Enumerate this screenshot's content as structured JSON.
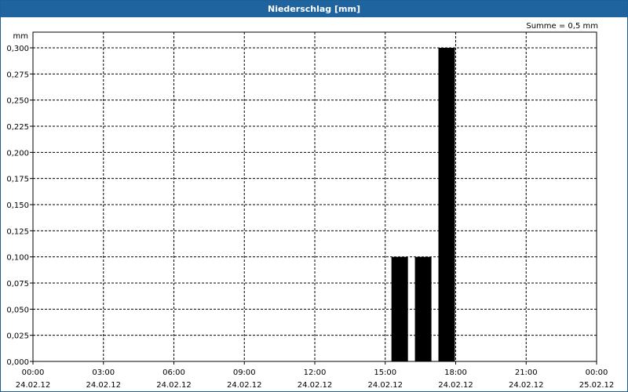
{
  "window": {
    "title": "Niederschlag [mm]"
  },
  "colors": {
    "titlebar": "#1f639f",
    "bar": "#000000",
    "grid": "#000000"
  },
  "chart_data": {
    "type": "bar",
    "title": "Niederschlag [mm]",
    "ylabel": "mm",
    "summary": "Summe = 0,5 mm",
    "ylim": [
      0,
      0.3
    ],
    "xlim": [
      "24.02.12 00:00",
      "25.02.12 00:00"
    ],
    "grid": true,
    "y_ticks": [
      "0,000",
      "0,025",
      "0,050",
      "0,075",
      "0,100",
      "0,125",
      "0,150",
      "0,175",
      "0,200",
      "0,225",
      "0,250",
      "0,275",
      "0,300"
    ],
    "x_ticks": [
      {
        "time": "00:00",
        "date": "24.02.12"
      },
      {
        "time": "03:00",
        "date": "24.02.12"
      },
      {
        "time": "06:00",
        "date": "24.02.12"
      },
      {
        "time": "09:00",
        "date": "24.02.12"
      },
      {
        "time": "12:00",
        "date": "24.02.12"
      },
      {
        "time": "15:00",
        "date": "24.02.12"
      },
      {
        "time": "18:00",
        "date": "24.02.12"
      },
      {
        "time": "21:00",
        "date": "24.02.12"
      },
      {
        "time": "00:00",
        "date": "25.02.12"
      }
    ],
    "bars": [
      {
        "hour": "16:00",
        "value": 0.1
      },
      {
        "hour": "17:00",
        "value": 0.1
      },
      {
        "hour": "18:00",
        "value": 0.3
      }
    ]
  }
}
